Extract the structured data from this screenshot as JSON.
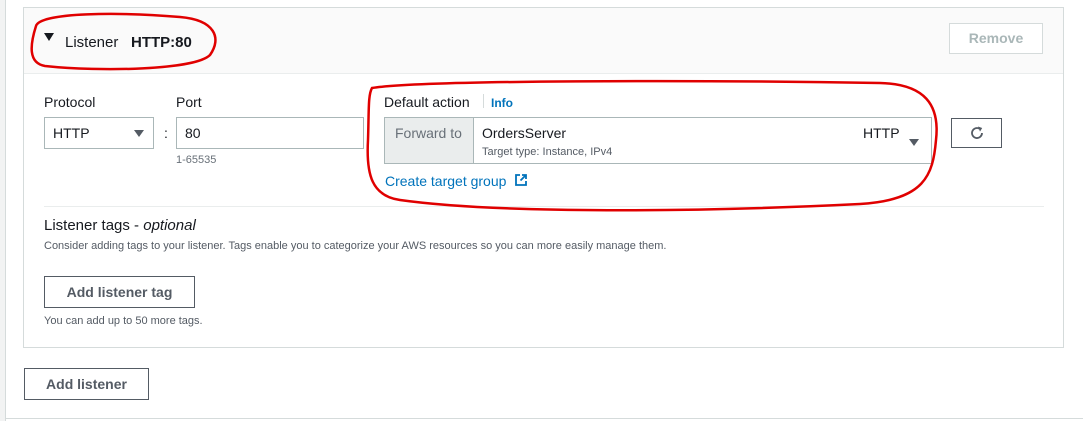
{
  "listener": {
    "label": "Listener",
    "value": "HTTP:80",
    "remove_label": "Remove"
  },
  "protocol": {
    "label": "Protocol",
    "value": "HTTP"
  },
  "port": {
    "label": "Port",
    "value": "80",
    "hint": "1-65535",
    "separator": ":"
  },
  "default_action": {
    "label": "Default action",
    "info_label": "Info",
    "action_type": "Forward to",
    "target_group": "OrdersServer",
    "target_desc": "Target type: Instance, IPv4",
    "target_protocol": "HTTP",
    "create_link": "Create target group"
  },
  "tags": {
    "title": "Listener tags",
    "title_dash": " - ",
    "title_optional": "optional",
    "description": "Consider adding tags to your listener. Tags enable you to categorize your AWS resources so you can more easily manage them.",
    "add_button": "Add listener tag",
    "hint": "You can add up to 50 more tags."
  },
  "add_listener_label": "Add listener",
  "colors": {
    "accent_link": "#0073bb",
    "annotation": "#e00000",
    "border": "#aab7b8"
  }
}
